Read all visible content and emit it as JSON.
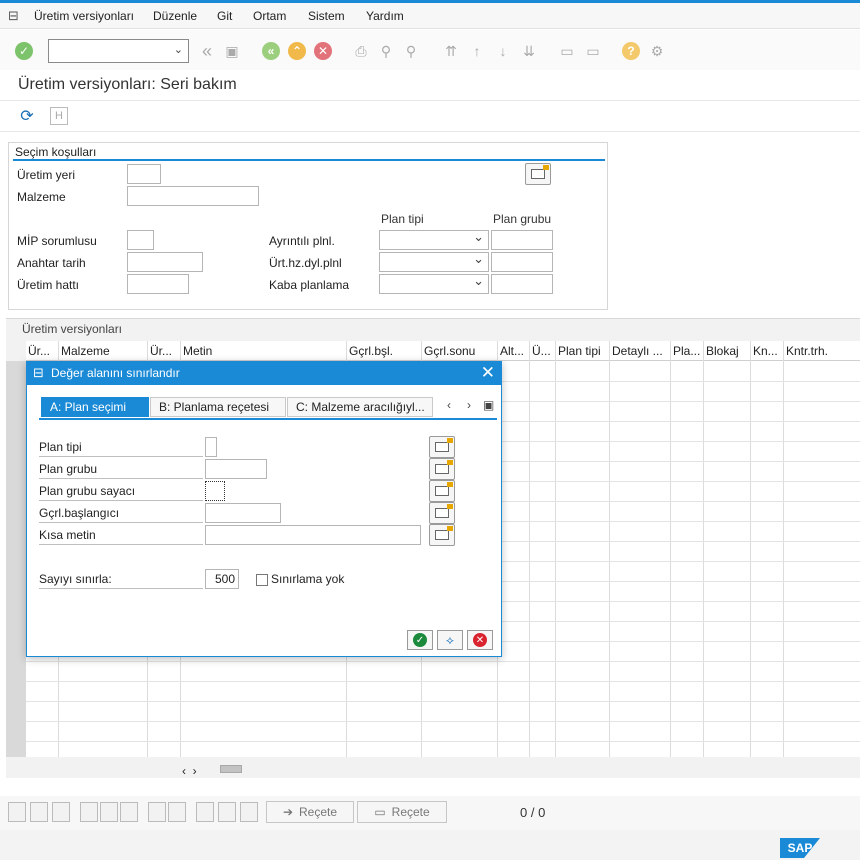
{
  "menu": [
    "Üretim versiyonları",
    "Düzenle",
    "Git",
    "Ortam",
    "Sistem",
    "Yardım"
  ],
  "page_title": "Üretim versiyonları: Seri bakım",
  "selection": {
    "title": "Seçim koşulları",
    "uretim_yeri": "Üretim yeri",
    "malzeme": "Malzeme",
    "plan_tipi_header": "Plan tipi",
    "plan_grubu_header": "Plan grubu",
    "mip_sorumlusu": "MİP sorumlusu",
    "anahtar_tarih": "Anahtar tarih",
    "uretim_hatti": "Üretim hattı",
    "ayrintili_plnl": "Ayrıntılı plnl.",
    "urt_hz_dyl_plnl": "Ürt.hz.dyl.plnl",
    "kaba_planlama": "Kaba planlama"
  },
  "grid": {
    "title": "Üretim versiyonları",
    "columns": [
      "Ür...",
      "Malzeme",
      "Ür...",
      "Metin",
      "Gçrl.bşl.",
      "Gçrl.sonu",
      "Alt...",
      "Ü...",
      "Plan tipi",
      "Detaylı ...",
      "Pla...",
      "Blokaj",
      "Kn...",
      "Kntr.trh."
    ]
  },
  "footer": {
    "recete_1": "Reçete",
    "recete_2": "Reçete",
    "counter": "0 / 0"
  },
  "dialog": {
    "title": "Değer alanını sınırlandır",
    "tabs": [
      "A: Plan seçimi",
      "B: Planlama reçetesi",
      "C: Malzeme aracılığıyl..."
    ],
    "fields": [
      "Plan tipi",
      "Plan grubu",
      "Plan grubu sayacı",
      "Gçrl.başlangıcı",
      "Kısa metin"
    ],
    "limit_label": "Sayıyı sınırla:",
    "limit_value": "500",
    "no_limit_label": "Sınırlama yok"
  },
  "brand": "SAP",
  "colors": {
    "accent": "#1a8ad6",
    "ok": "#1b8a3c",
    "cancel": "#d9232e",
    "highlight": "#e6a700"
  }
}
